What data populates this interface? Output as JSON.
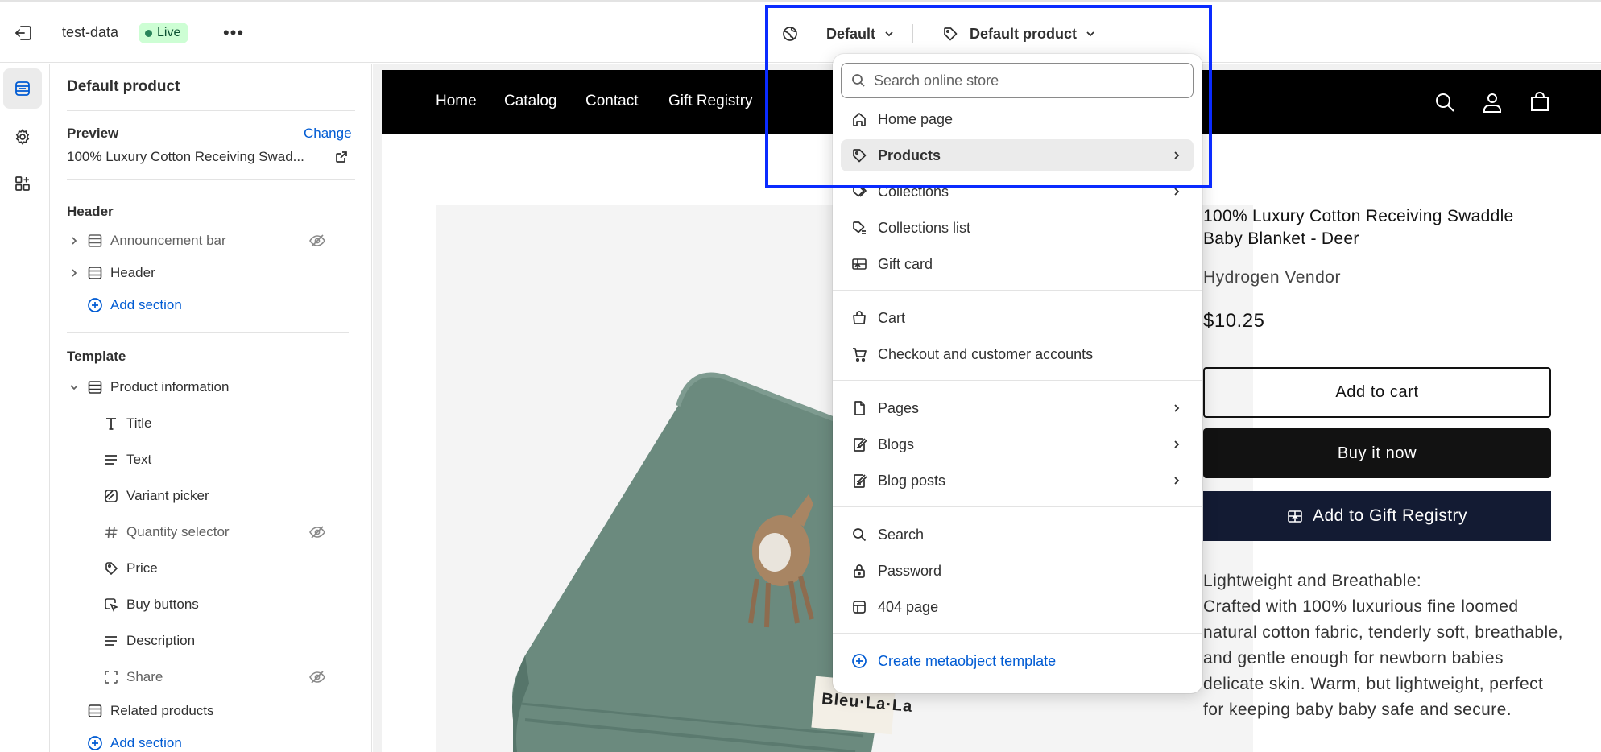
{
  "topbar": {
    "store_name": "test-data",
    "status_badge": "Live",
    "more_label": "•••",
    "theme_dropdown": "Default",
    "template_dropdown": "Default product"
  },
  "sidebar": {
    "title": "Default product",
    "preview_label": "Preview",
    "change_link": "Change",
    "preview_product": "100% Luxury Cotton Receiving Swad...",
    "header_group": {
      "label": "Header",
      "items": [
        {
          "label": "Announcement bar",
          "hidden": true
        },
        {
          "label": "Header",
          "hidden": false
        }
      ],
      "add_section": "Add section"
    },
    "template_group": {
      "label": "Template",
      "section": "Product information",
      "blocks": [
        {
          "label": "Title",
          "icon": "title-icon",
          "hidden": false
        },
        {
          "label": "Text",
          "icon": "text-icon",
          "hidden": false
        },
        {
          "label": "Variant picker",
          "icon": "variant-icon",
          "hidden": false
        },
        {
          "label": "Quantity selector",
          "icon": "hash-icon",
          "hidden": true
        },
        {
          "label": "Price",
          "icon": "price-tag-icon",
          "hidden": false
        },
        {
          "label": "Buy buttons",
          "icon": "cursor-icon",
          "hidden": false
        },
        {
          "label": "Description",
          "icon": "text-icon",
          "hidden": false
        },
        {
          "label": "Share",
          "icon": "share-icon",
          "hidden": true
        }
      ],
      "related": "Related products",
      "add_section": "Add section"
    }
  },
  "store": {
    "nav": [
      "Home",
      "Catalog",
      "Contact",
      "Gift Registry"
    ],
    "product": {
      "title": "100% Luxury Cotton Receiving Swaddle Baby Blanket - Deer",
      "vendor": "Hydrogen Vendor",
      "price": "$10.25",
      "add_to_cart": "Add to cart",
      "buy_now": "Buy it now",
      "gift_registry": "Add to Gift Registry",
      "description_heading": "Lightweight and Breathable:",
      "description": "Crafted with 100% luxurious fine loomed natural cotton fabric, tenderly soft, breathable, and gentle enough for newborn babies delicate skin. Warm, but lightweight, perfect for keeping baby baby safe and secure.",
      "label_brand": "Bleu·La·La"
    }
  },
  "dropdown": {
    "search_placeholder": "Search online store",
    "items": [
      {
        "label": "Home page",
        "icon": "home-icon",
        "submenu": false
      },
      {
        "label": "Products",
        "icon": "tag-icon",
        "submenu": true,
        "selected": true
      },
      {
        "label": "Collections",
        "icon": "collections-icon",
        "submenu": true
      },
      {
        "label": "Collections list",
        "icon": "collections-list-icon",
        "submenu": false
      },
      {
        "label": "Gift card",
        "icon": "gift-card-icon",
        "submenu": false
      },
      {
        "label": "Cart",
        "icon": "bag-icon",
        "submenu": false
      },
      {
        "label": "Checkout and customer accounts",
        "icon": "cart-icon",
        "submenu": false
      },
      {
        "label": "Pages",
        "icon": "page-icon",
        "submenu": true
      },
      {
        "label": "Blogs",
        "icon": "blog-icon",
        "submenu": true
      },
      {
        "label": "Blog posts",
        "icon": "blog-post-icon",
        "submenu": true
      },
      {
        "label": "Search",
        "icon": "search-icon",
        "submenu": false
      },
      {
        "label": "Password",
        "icon": "lock-icon",
        "submenu": false
      },
      {
        "label": "404 page",
        "icon": "error-page-icon",
        "submenu": false
      }
    ],
    "create_link": "Create metaobject template"
  },
  "colors": {
    "accent": "#005bd3",
    "live_badge_bg": "#cdfed4",
    "store_nav_bg": "#000000",
    "gift_button_bg": "#131b33",
    "highlight_border": "#0a2bff"
  }
}
